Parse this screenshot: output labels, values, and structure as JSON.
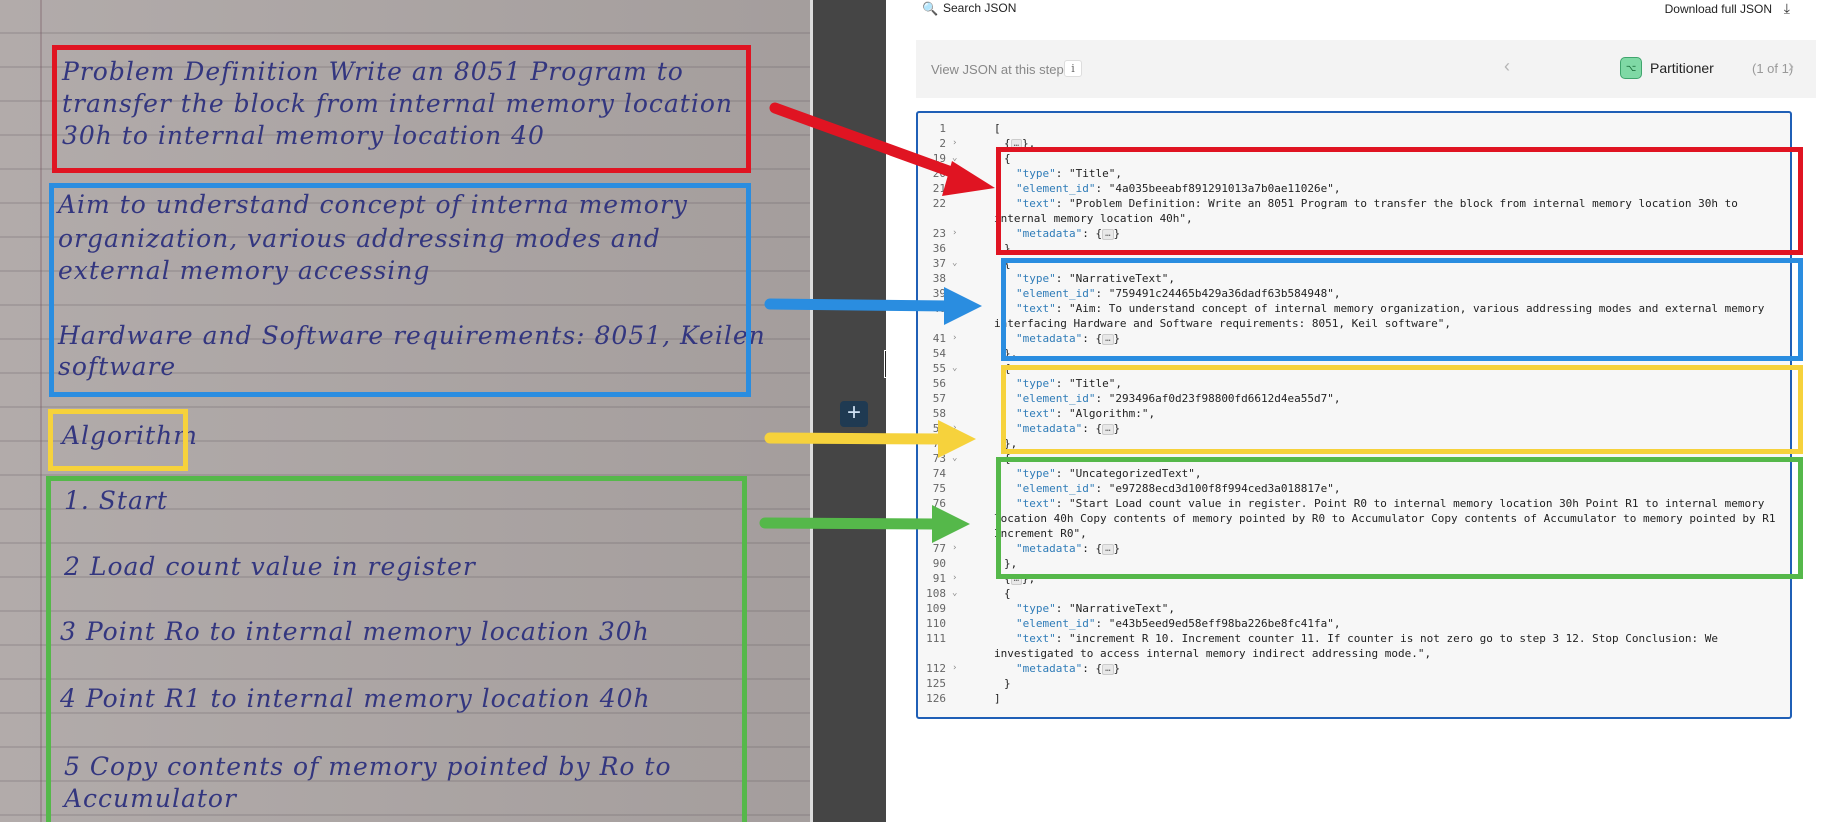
{
  "toolbar": {
    "search_label": "Search JSON",
    "download_label": "Download full JSON",
    "search_icon": "🔍",
    "download_icon": "⤓"
  },
  "stepbar": {
    "label": "View JSON at this step",
    "info_icon": "i",
    "partitioner_icon": "⌥",
    "partitioner_label": "Partitioner",
    "partitioner_count": "(1 of 1)",
    "prev_icon": "‹",
    "next_icon": "›"
  },
  "splitter": {
    "add_icon": "+"
  },
  "handwriting": {
    "line1": "Problem Definition Write an 8051 Program to",
    "line2": "transfer the block from internal memory location",
    "line3": "30h to internal memory location 40",
    "line4": "Aim to understand concept of interna memory",
    "line5": "organization, various addressing modes and",
    "line6": "external memory accessing",
    "line7": "Hardware and Software requirements: 8051, Keilen",
    "line8": "software",
    "line9": "Algorithm",
    "line10": "1. Start",
    "line11": "2 Load count value in register",
    "line12": "3 Point Ro to internal memory location 30h",
    "line13": "4 Point R1 to internal memory location 40h",
    "line14": "5 Copy contents of memory pointed by Ro to",
    "line15": "Accumulator"
  },
  "json_lines": {
    "l1": {
      "n": "1",
      "t": "["
    },
    "l2": {
      "n": "2",
      "t": "{"
    },
    "l3": {
      "n": "19",
      "t": "{"
    },
    "l4": {
      "n": "20",
      "k": "\"type\"",
      "v": ": \"Title\","
    },
    "l5": {
      "n": "21",
      "k": "\"element_id\"",
      "v": ": \"4a035beeabf891291013a7b0ae11026e\","
    },
    "l6": {
      "n": "22",
      "k": "\"text\"",
      "v": ": \"Problem Definition: Write an 8051 Program to transfer the block from internal memory location 30h to internal memory location 40h\","
    },
    "l7": {
      "n": "23",
      "k": "\"metadata\"",
      "v": ": {"
    },
    "l8": {
      "n": "36",
      "t": "},"
    },
    "l9": {
      "n": "37",
      "t": "{"
    },
    "l10": {
      "n": "38",
      "k": "\"type\"",
      "v": ": \"NarrativeText\","
    },
    "l11": {
      "n": "39",
      "k": "\"element_id\"",
      "v": ": \"759491c24465b429a36dadf63b584948\","
    },
    "l12": {
      "n": "40",
      "k": "\"text\"",
      "v": ": \"Aim: To understand concept of internal memory organization, various addressing modes and external memory interfacing Hardware and Software requirements: 8051, Keil software\","
    },
    "l13": {
      "n": "41",
      "k": "\"metadata\"",
      "v": ": {"
    },
    "l14": {
      "n": "54",
      "t": "},"
    },
    "l15": {
      "n": "55",
      "t": "{"
    },
    "l16": {
      "n": "56",
      "k": "\"type\"",
      "v": ": \"Title\","
    },
    "l17": {
      "n": "57",
      "k": "\"element_id\"",
      "v": ": \"293496af0d23f98800fd6612d4ea55d7\","
    },
    "l18": {
      "n": "58",
      "k": "\"text\"",
      "v": ": \"Algorithm:\","
    },
    "l19": {
      "n": "59",
      "k": "\"metadata\"",
      "v": ": {"
    },
    "l20": {
      "n": "72",
      "t": "},"
    },
    "l21": {
      "n": "73",
      "t": "{"
    },
    "l22": {
      "n": "74",
      "k": "\"type\"",
      "v": ": \"UncategorizedText\","
    },
    "l23": {
      "n": "75",
      "k": "\"element_id\"",
      "v": ": \"e97288ecd3d100f8f994ced3a018817e\","
    },
    "l24": {
      "n": "76",
      "k": "\"text\"",
      "v": ": \"Start Load count value in register. Point R0 to internal memory location 30h Point R1 to internal memory location 40h Copy contents of memory pointed by R0 to Accumulator Copy contents of Accumulator to memory pointed by R1 Increment R0\","
    },
    "l25": {
      "n": "77",
      "k": "\"metadata\"",
      "v": ": {"
    },
    "l26": {
      "n": "90",
      "t": "},"
    },
    "l27": {
      "n": "91",
      "t": "{"
    },
    "l28": {
      "n": "108",
      "t": "{"
    },
    "l29": {
      "n": "109",
      "k": "\"type\"",
      "v": ": \"NarrativeText\","
    },
    "l30": {
      "n": "110",
      "k": "\"element_id\"",
      "v": ": \"e43b5eed9ed58eff98ba226be8fc41fa\","
    },
    "l31": {
      "n": "111",
      "k": "\"text\"",
      "v": ": \"increment R 10. Increment counter 11. If counter is not zero go to step 3 12. Stop Conclusion: We investigated to access internal memory indirect addressing mode.\","
    },
    "l32": {
      "n": "112",
      "k": "\"metadata\"",
      "v": ": {"
    },
    "l33": {
      "n": "125",
      "t": "}"
    },
    "l34": {
      "n": "126",
      "t": "]"
    },
    "collapsed": "…",
    "close_brace": "}",
    "close_brace_comma": "},",
    "fold_open": "⌄",
    "fold_closed": "›"
  },
  "colors": {
    "red": "#e01422",
    "blue": "#2a8de0",
    "yellow": "#f6d23c",
    "green": "#55b84a",
    "key": "#2f7cb8",
    "panel_border": "#1f5fb6"
  }
}
